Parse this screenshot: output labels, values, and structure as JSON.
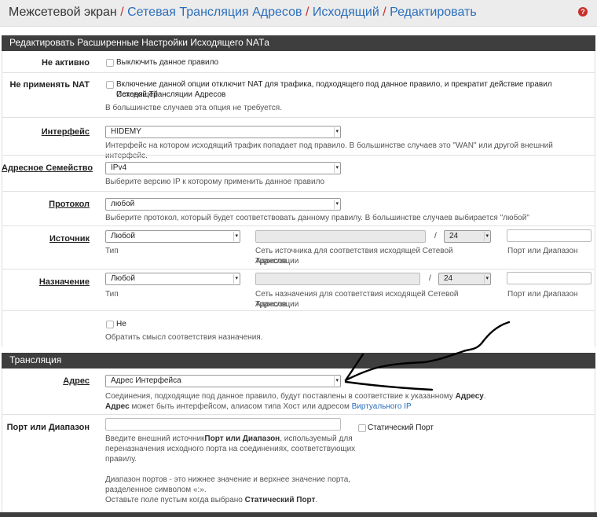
{
  "breadcrumb": {
    "root": "Межсетевой экран",
    "items": [
      "Сетевая Трансляция Адресов",
      "Исходящий",
      "Редактировать"
    ],
    "separator": "/"
  },
  "panel_edit": {
    "title": "Редактировать Расширенные Настройки Исходящего NATа"
  },
  "disabled": {
    "label": "Не активно",
    "checkbox_label": "Выключить данное правило"
  },
  "nonat": {
    "label": "Не применять NAT",
    "checkbox_label_1": "Включение данной опции отключит NAT для трафика, подходящего под данное правило, и прекратит действие правил Исходящей",
    "checkbox_label_2": "Сетевой Трансляции Адресов",
    "help": "В большинстве случаев эта опция не требуется."
  },
  "interface": {
    "label": "Интерфейс",
    "value": "HIDEMY",
    "help": "Интерфейс на котором исходящий трафик попадает под правило. В большинстве случаев это \"WAN\" или другой внешний интерфейс."
  },
  "family": {
    "label": "Адресное Семейство",
    "value": "IPv4",
    "help": "Выберите версию IP к которому применить данное правило"
  },
  "protocol": {
    "label": "Протокол",
    "value": "любой",
    "help": "Выберите протокол, который будет соответствовать данному правилу. В большинстве случаев выбирается \"любой\""
  },
  "source": {
    "label": "Источник",
    "type_value": "Любой",
    "type_help": "Тип",
    "mask": "24",
    "net_help_1": "Сеть источника для соответствия исходящей Сетевой Трансляции",
    "net_help_2": "Адресов.",
    "port_help": "Порт или Диапазон"
  },
  "destination": {
    "label": "Назначение",
    "type_value": "Любой",
    "type_help": "Тип",
    "mask": "24",
    "net_help_1": "Сеть назначения для соответствия исходящей Сетевой Трансляции",
    "net_help_2": "Адресов.",
    "port_help": "Порт или Диапазон",
    "not_label": "Не",
    "not_help": "Обратить смысл соответствия назначения."
  },
  "panel_translation": {
    "title": "Трансляция"
  },
  "address": {
    "label": "Адрес",
    "value": "Адрес Интерфейса",
    "help_1a": "Соединения, подходящие под данное правило, будут поставлены в соответствие к указанному ",
    "help_1b": "Адресу",
    "help_1c": ".",
    "help_2a": "Адрес",
    "help_2b": " может быть интерфейсом, алиасом типа Хост или адресом ",
    "help_2c": "Виртуального IP"
  },
  "port": {
    "label": "Порт или Диапазон",
    "static_label": "Статический Порт",
    "help_1a": "Введите внешний источник",
    "help_1b": "Порт или Диапазон",
    "help_1c": ", используемый для",
    "help_2": "переназначения исходного порта на соединениях, соответствующих",
    "help_3": "правилу.",
    "help_4": "Диапазон портов - это нижнее значение и верхнее значение порта,",
    "help_5": "разделенное символом «:».",
    "help_6a": "Оставьте поле пустым когда выбрано ",
    "help_6b": "Статический Порт",
    "help_6c": "."
  },
  "colors": {
    "panel_header": "#3e3e3e",
    "link": "#2a6ebb",
    "breadcrumb_separator": "#c9302c",
    "scribble": "#000000"
  },
  "icons": [
    "help-icon",
    "dropdown-arrow-icon"
  ]
}
